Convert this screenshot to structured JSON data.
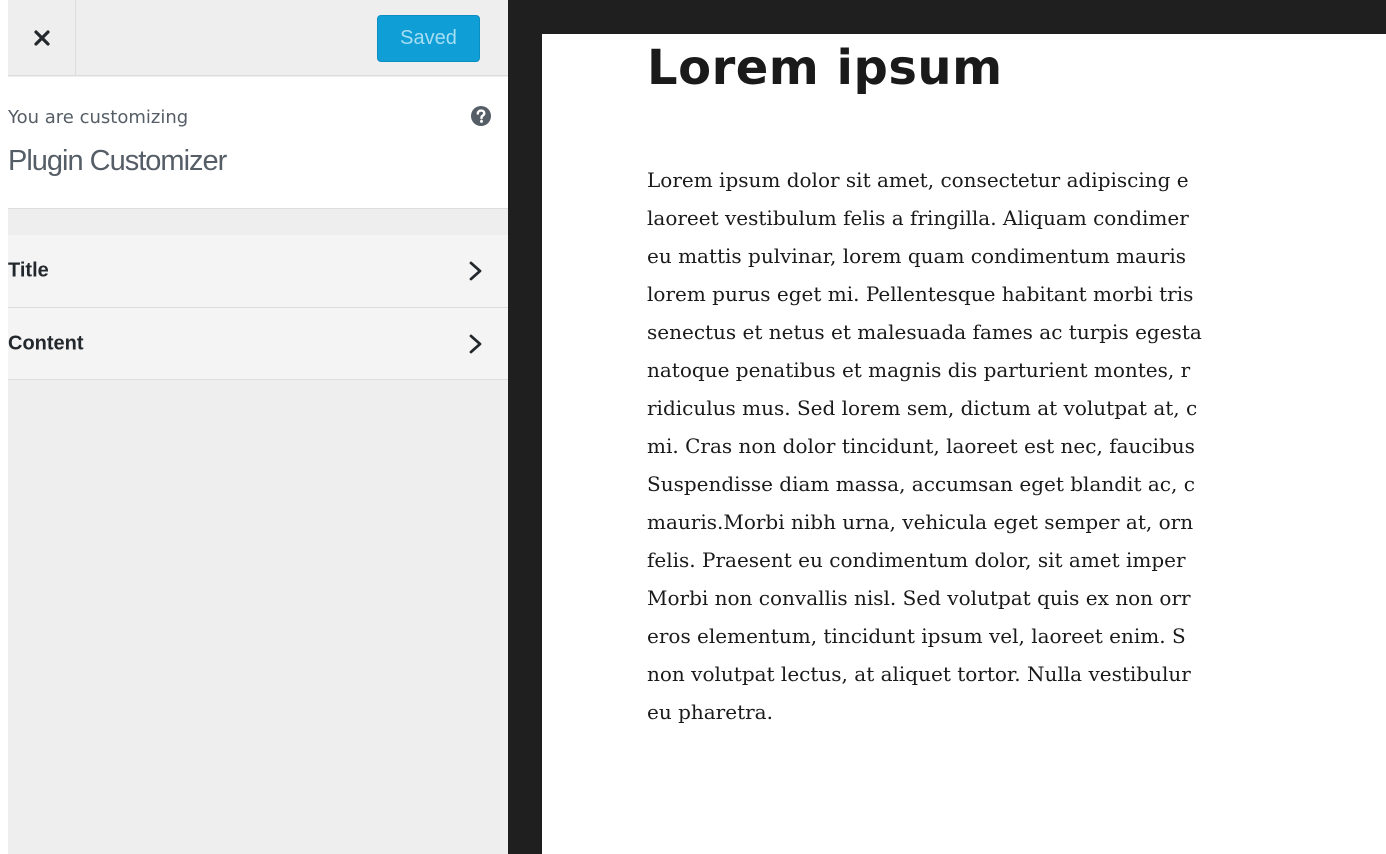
{
  "sidebar": {
    "header": {
      "close_icon": "close-icon",
      "save_button_label": "Saved"
    },
    "info": {
      "label": "You are customizing",
      "title": "Plugin Customizer",
      "help_icon": "question-circle-icon"
    },
    "sections": [
      {
        "label": "Title",
        "icon": "chevron-right-icon"
      },
      {
        "label": "Content",
        "icon": "chevron-right-icon"
      }
    ]
  },
  "preview": {
    "title": "Lorem ipsum",
    "body_lines": [
      "Lorem ipsum dolor sit amet, consectetur adipiscing e",
      "laoreet vestibulum felis a fringilla. Aliquam condimer",
      "eu mattis pulvinar, lorem quam condimentum mauris",
      "lorem purus eget mi. Pellentesque habitant morbi tris",
      "senectus et netus et malesuada fames ac turpis egesta",
      "natoque penatibus et magnis dis parturient montes, r",
      "ridiculus mus. Sed lorem sem, dictum at volutpat at, c",
      "mi. Cras non dolor tincidunt, laoreet est nec, faucibus",
      "Suspendisse diam massa, accumsan eget blandit ac, c",
      "mauris.Morbi nibh urna, vehicula eget semper at, orn",
      "felis. Praesent eu condimentum dolor, sit amet imper",
      "Morbi non convallis nisl. Sed volutpat quis ex non orr",
      "eros elementum, tincidunt ipsum vel, laoreet enim. S",
      "non volutpat lectus, at aliquet tortor. Nulla vestibulur",
      "eu pharetra."
    ]
  },
  "colors": {
    "accent": "#0f9fd6",
    "sidebar_bg": "#eeeeee",
    "preview_frame": "#1f1f1f"
  }
}
